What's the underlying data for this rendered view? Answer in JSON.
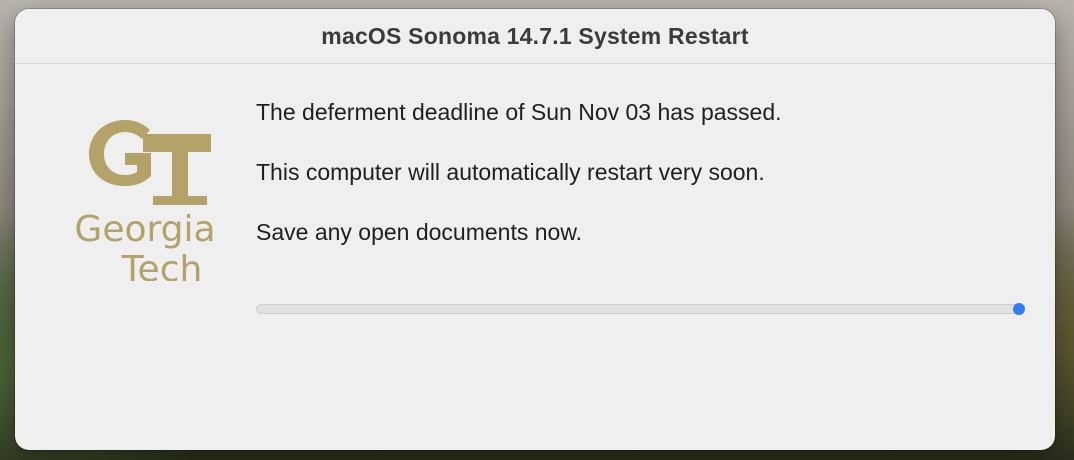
{
  "window": {
    "title": "macOS Sonoma 14.7.1 System Restart"
  },
  "logo": {
    "monogram": "GT",
    "line1": "Georgia",
    "line2": "Tech",
    "color": "#b3a369"
  },
  "messages": [
    "The deferment deadline of Sun Nov 03 has passed.",
    "This computer will automatically restart very soon.",
    "Save any open documents now."
  ],
  "progress": {
    "fraction": 1.0,
    "accent": "#2f7cf6"
  }
}
